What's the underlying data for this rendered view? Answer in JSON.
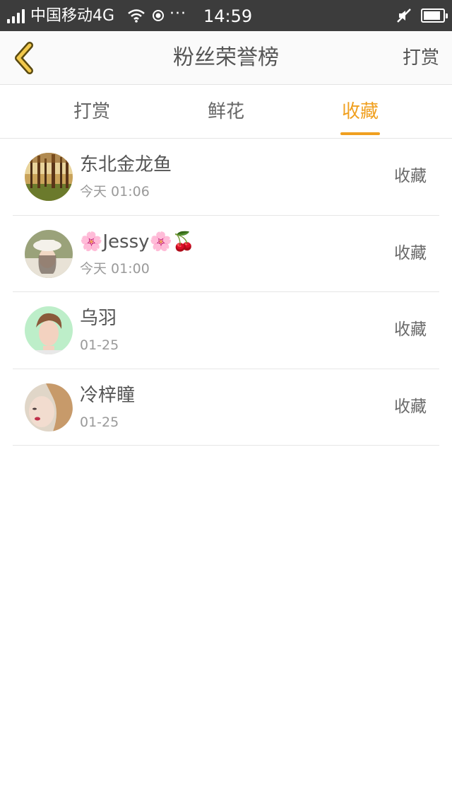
{
  "status_bar": {
    "carrier": "中国移动4G",
    "dots": "···",
    "time": "14:59",
    "battery_level": 0.9,
    "icons": [
      "signal-icon",
      "wifi-icon",
      "location-icon",
      "mute-icon",
      "battery-icon"
    ]
  },
  "nav": {
    "back_icon": "chevron-left-icon",
    "title": "粉丝荣誉榜",
    "action_label": "打赏"
  },
  "tabs": [
    {
      "label": "打赏",
      "active": false
    },
    {
      "label": "鲜花",
      "active": false
    },
    {
      "label": "收藏",
      "active": true
    }
  ],
  "accent_color": "#f0a020",
  "fans": [
    {
      "name": "东北金龙鱼",
      "time": "今天 01:06",
      "type": "收藏",
      "avatar": "forest-avatar"
    },
    {
      "name": "🌸Jessy🌸🍒",
      "time": "今天 01:00",
      "type": "收藏",
      "avatar": "girl-hat-avatar"
    },
    {
      "name": "乌羽",
      "time": "01-25",
      "type": "收藏",
      "avatar": "boy-portrait-avatar"
    },
    {
      "name": "冷梓瞳",
      "time": "01-25",
      "type": "收藏",
      "avatar": "girl-portrait-avatar"
    }
  ]
}
